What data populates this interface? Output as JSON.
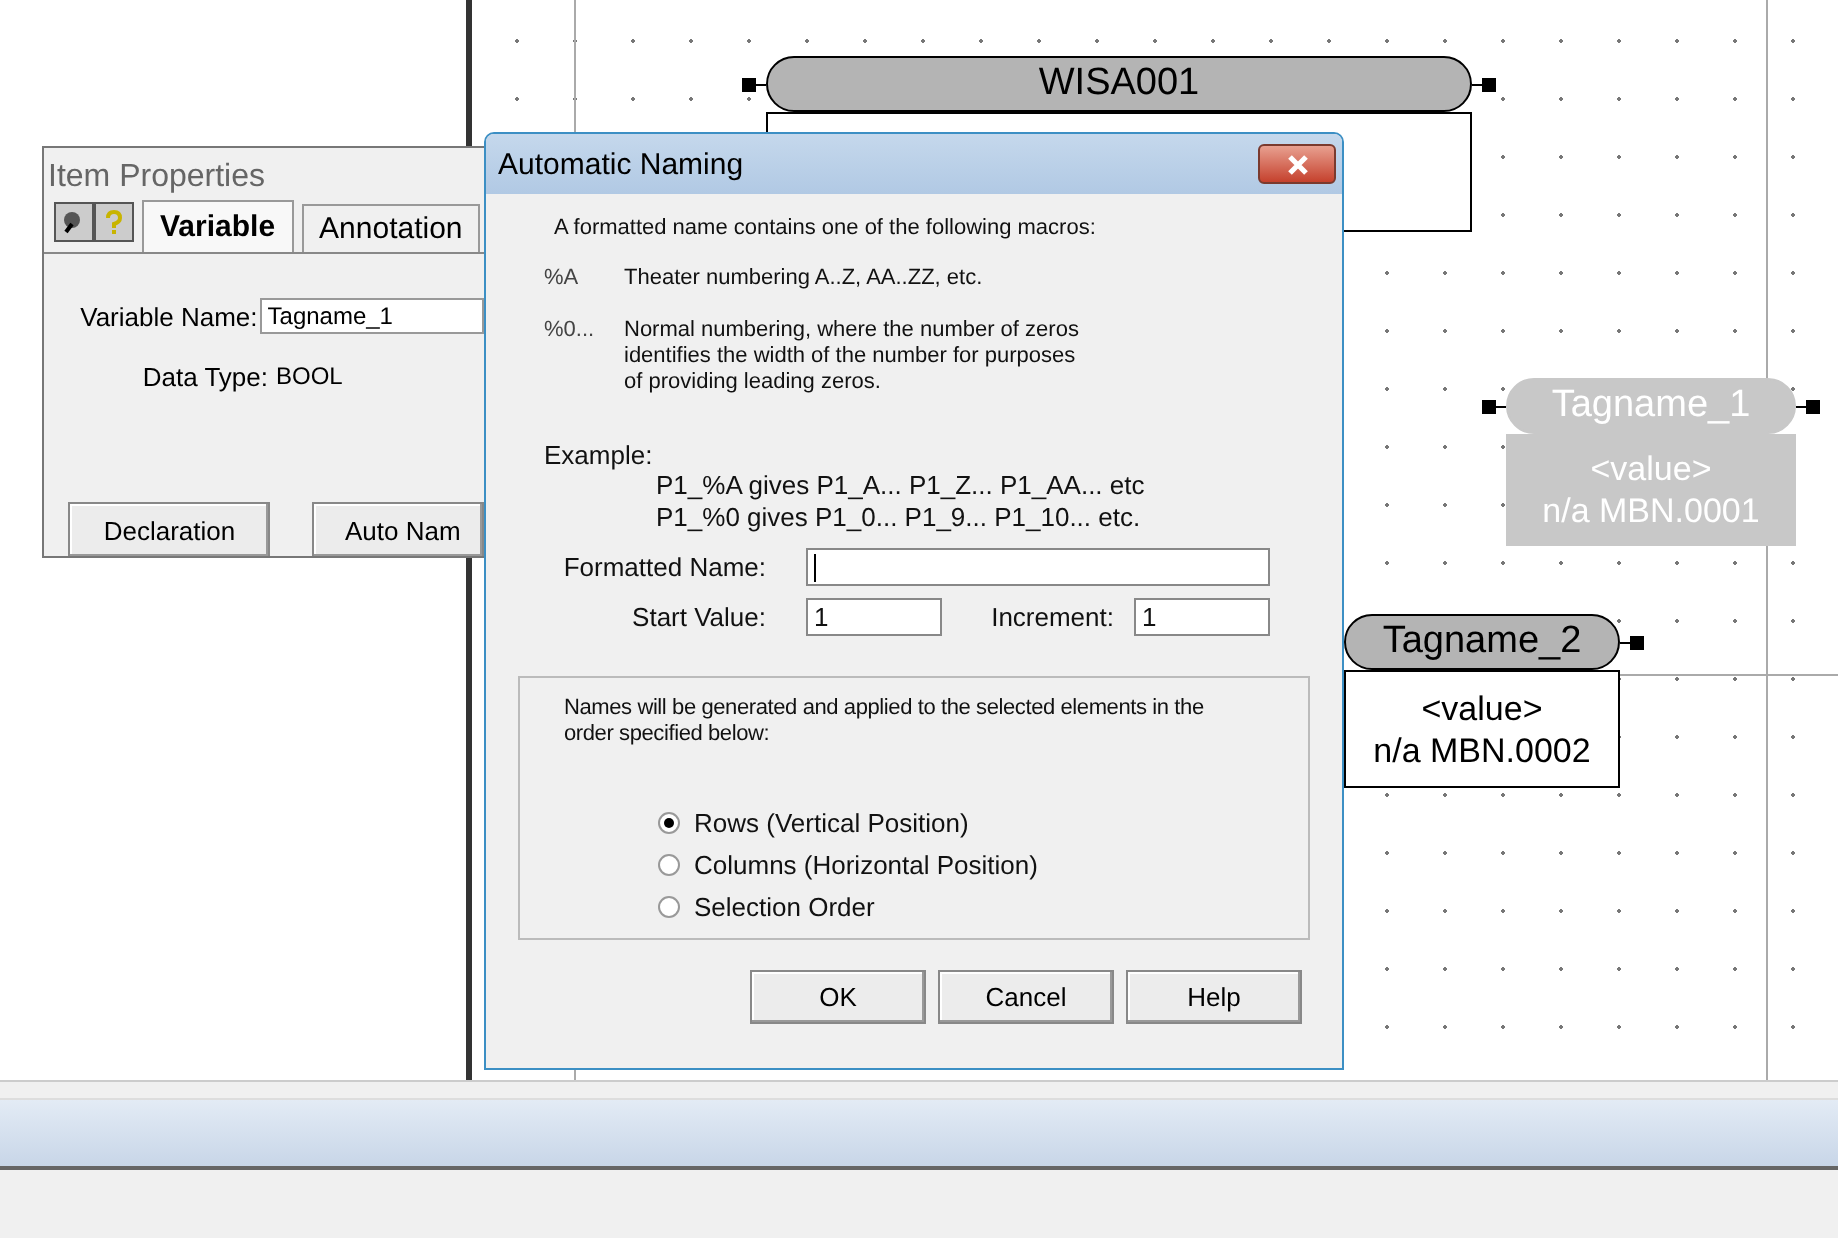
{
  "canvas": {
    "nodes": [
      {
        "name": "WISA001",
        "dimmed": false
      },
      {
        "name": "Tagname_1",
        "dimmed": true,
        "lines": [
          "<value>",
          "n/a MBN.0001"
        ]
      },
      {
        "name": "Tagname_2",
        "dimmed": false,
        "lines": [
          "<value>",
          "n/a MBN.0002"
        ]
      }
    ]
  },
  "item_properties": {
    "title": "Item Properties",
    "tabs": [
      {
        "label": "Variable",
        "selected": true
      },
      {
        "label": "Annotation",
        "selected": false
      }
    ],
    "fields": [
      {
        "label": "Variable Name:",
        "value": "Tagname_1",
        "kind": "input"
      },
      {
        "label": "Data Type:",
        "value": "BOOL",
        "kind": "text"
      }
    ],
    "buttons": [
      "Declaration",
      "Auto Nam"
    ]
  },
  "dialog": {
    "title": "Automatic Naming",
    "intro": "A formatted name contains one of the following macros:",
    "macros": [
      {
        "code": "%A",
        "text": "Theater numbering A..Z, AA..ZZ, etc."
      },
      {
        "code": "%0...",
        "text": "Normal numbering, where the number of zeros identifies the width of the number for purposes of providing leading zeros."
      }
    ],
    "example_label": "Example:",
    "examples": [
      "P1_%A gives P1_A... P1_Z... P1_AA... etc",
      "P1_%0 gives P1_0... P1_9... P1_10... etc."
    ],
    "formatted_name": {
      "label": "Formatted Name:"
    },
    "start_value": {
      "label": "Start Value:",
      "value": "1"
    },
    "increment": {
      "label": "Increment:",
      "value": "1"
    },
    "order_note": "Names will be generated and applied to the selected elements in the order specified below:",
    "order_options": [
      {
        "label": "Rows  (Vertical Position)",
        "selected": true
      },
      {
        "label": "Columns (Horizontal Position)",
        "selected": false
      },
      {
        "label": "Selection Order",
        "selected": false
      }
    ],
    "buttons": [
      "OK",
      "Cancel",
      "Help"
    ]
  }
}
